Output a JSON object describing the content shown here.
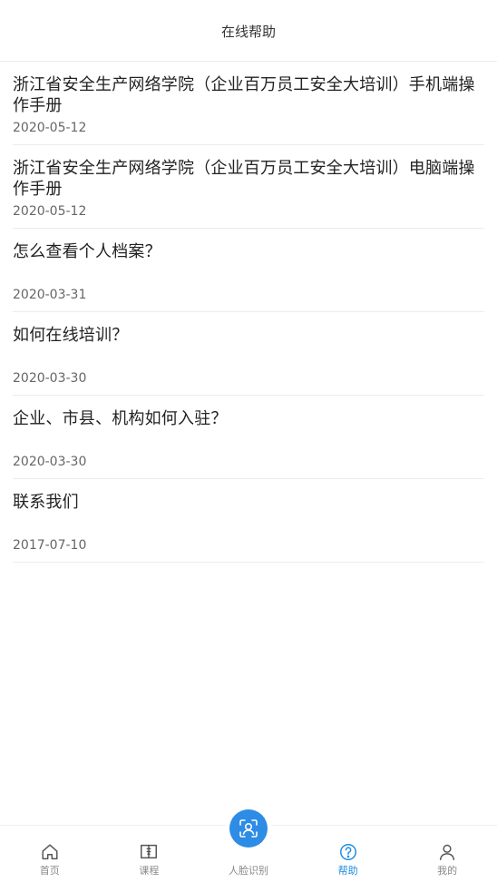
{
  "header": {
    "title": "在线帮助"
  },
  "articles": [
    {
      "title": "浙江省安全生产网络学院（企业百万员工安全大培训）手机端操作手册",
      "date": "2020-05-12"
    },
    {
      "title": "浙江省安全生产网络学院（企业百万员工安全大培训）电脑端操作手册",
      "date": "2020-05-12"
    },
    {
      "title": "怎么查看个人档案？",
      "date": "2020-03-31"
    },
    {
      "title": "如何在线培训？",
      "date": "2020-03-30"
    },
    {
      "title": "企业、市县、机构如何入驻？",
      "date": "2020-03-30"
    },
    {
      "title": "联系我们",
      "date": "2017-07-10"
    }
  ],
  "tabbar": {
    "active_color": "#1c8be0",
    "inactive_color": "#888888",
    "items": [
      {
        "label": "首页",
        "icon": "home-icon"
      },
      {
        "label": "课程",
        "icon": "book-icon"
      },
      {
        "label": "人脸识别",
        "icon": "face-scan-icon"
      },
      {
        "label": "帮助",
        "icon": "help-icon",
        "active": true
      },
      {
        "label": "我的",
        "icon": "user-icon"
      }
    ]
  }
}
